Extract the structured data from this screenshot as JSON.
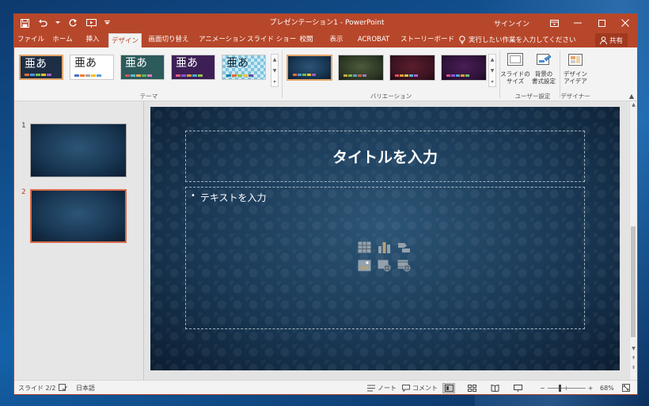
{
  "app": {
    "title": "プレゼンテーション1 - PowerPoint",
    "signin": "サインイン",
    "share": "共有",
    "tell_me": "実行したい作業を入力してください"
  },
  "tabs": [
    "ファイル",
    "ホーム",
    "挿入",
    "デザイン",
    "画面切り替え",
    "アニメーション",
    "スライド ショー",
    "校閲",
    "表示",
    "ACROBAT",
    "ストーリーボード"
  ],
  "active_tab": "デザイン",
  "ribbon": {
    "theme_group_label": "テーマ",
    "variation_group_label": "バリエーション",
    "customize_group_label": "ユーザー設定",
    "designer_group_label": "デザイナー",
    "theme_thumb_text": "亜あ",
    "slide_size": {
      "line1": "スライドの",
      "line2": "サイズ"
    },
    "format_background": {
      "line1": "背景の",
      "line2": "書式設定"
    },
    "design_ideas": {
      "line1": "デザイン",
      "line2": "アイデア"
    }
  },
  "slide": {
    "title_placeholder": "タイトルを入力",
    "body_placeholder": "テキストを入力",
    "bullet": "•"
  },
  "slide_numbers": [
    "1",
    "2"
  ],
  "status": {
    "slide_counter": "スライド 2/2",
    "language": "日本語",
    "notes": "ノート",
    "comments": "コメント",
    "zoom": "68%",
    "zoom_level_fraction": 0.68,
    "minus": "−",
    "plus": "+"
  },
  "colors": {
    "accent": "#b7472a",
    "slide_bg": "#1a3956"
  }
}
